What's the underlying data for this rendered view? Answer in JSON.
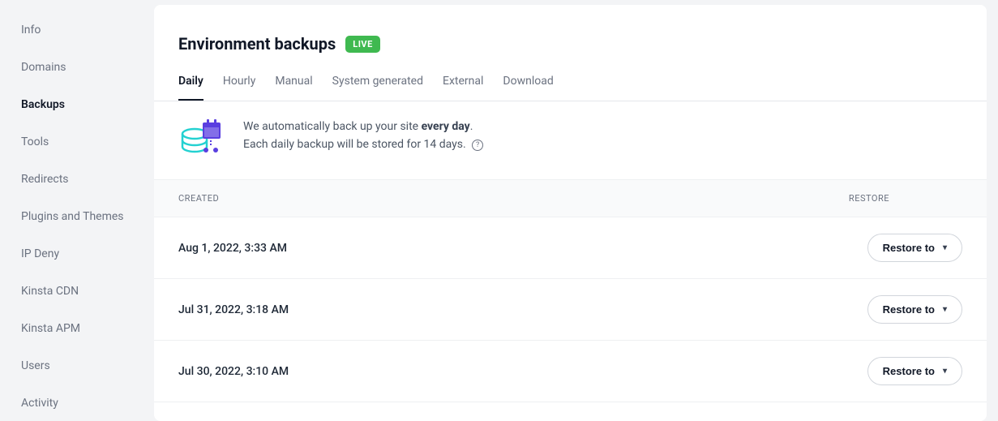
{
  "sidebar": {
    "items": [
      {
        "label": "Info",
        "active": false
      },
      {
        "label": "Domains",
        "active": false
      },
      {
        "label": "Backups",
        "active": true
      },
      {
        "label": "Tools",
        "active": false
      },
      {
        "label": "Redirects",
        "active": false
      },
      {
        "label": "Plugins and Themes",
        "active": false
      },
      {
        "label": "IP Deny",
        "active": false
      },
      {
        "label": "Kinsta CDN",
        "active": false
      },
      {
        "label": "Kinsta APM",
        "active": false
      },
      {
        "label": "Users",
        "active": false
      },
      {
        "label": "Activity",
        "active": false
      }
    ]
  },
  "header": {
    "title": "Environment backups",
    "badge": "LIVE"
  },
  "tabs": [
    {
      "label": "Daily",
      "active": true
    },
    {
      "label": "Hourly",
      "active": false
    },
    {
      "label": "Manual",
      "active": false
    },
    {
      "label": "System generated",
      "active": false
    },
    {
      "label": "External",
      "active": false
    },
    {
      "label": "Download",
      "active": false
    }
  ],
  "info": {
    "line1_prefix": "We automatically back up your site ",
    "line1_bold": "every day",
    "line1_suffix": ".",
    "line2": "Each daily backup will be stored for 14 days.",
    "help": "?"
  },
  "table": {
    "head_created": "CREATED",
    "head_restore": "RESTORE",
    "restore_label": "Restore to",
    "rows": [
      {
        "created": "Aug 1, 2022, 3:33 AM"
      },
      {
        "created": "Jul 31, 2022, 3:18 AM"
      },
      {
        "created": "Jul 30, 2022, 3:10 AM"
      }
    ]
  }
}
